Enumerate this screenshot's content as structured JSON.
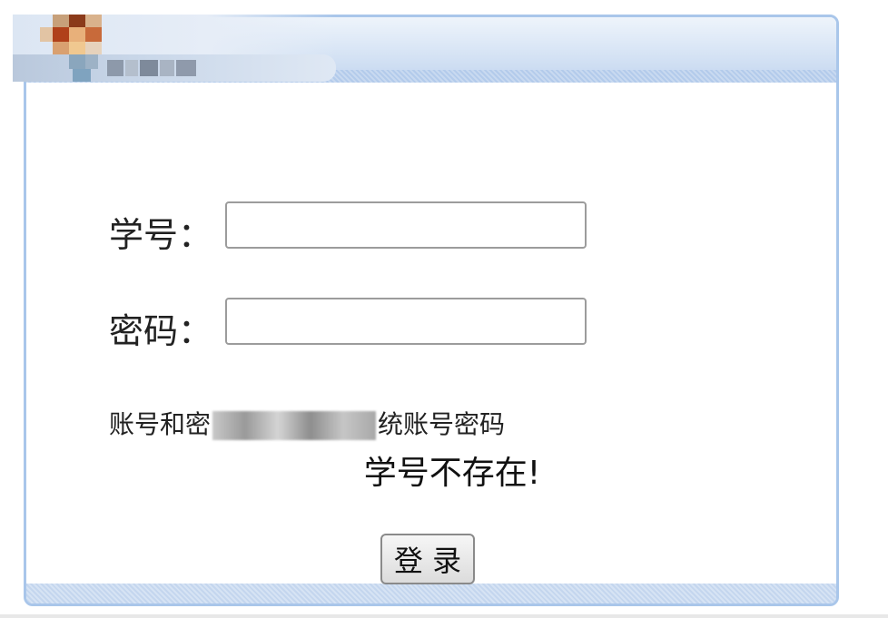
{
  "form": {
    "student_id_label": "学号：",
    "student_id_value": "",
    "password_label": "密码：",
    "password_value": "",
    "hint_prefix": "账号和密",
    "hint_suffix": "统账号密码",
    "error_message": "学号不存在!",
    "login_label": "登 录"
  },
  "colors": {
    "panel_border": "#a9c6ea",
    "header_gradient_top": "#eef4fb",
    "header_gradient_bottom": "#c3d6ef"
  }
}
